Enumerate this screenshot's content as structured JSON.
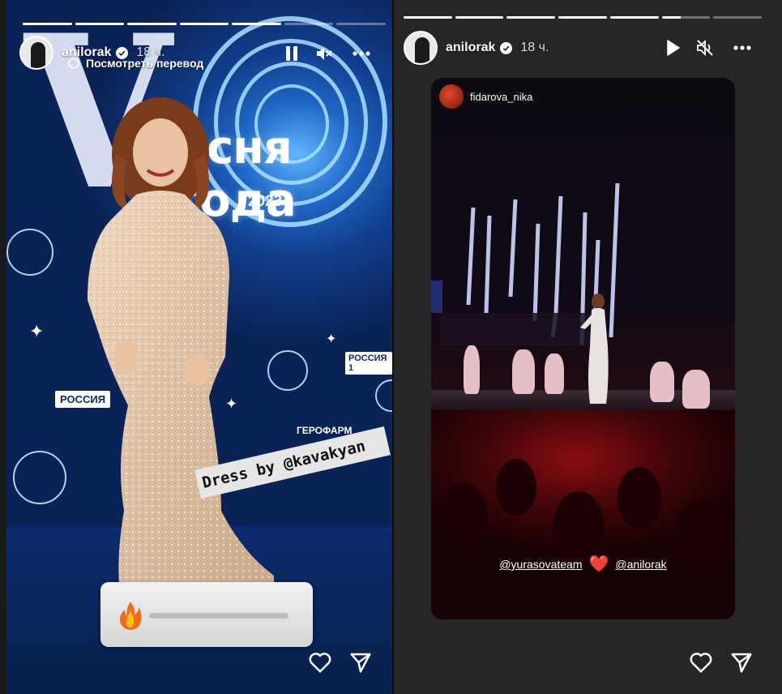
{
  "left_story": {
    "username": "anilorak",
    "time": "18 ч.",
    "translate_label": "Посмотреть перевод",
    "progress": [
      1,
      1,
      1,
      1,
      1,
      0,
      0
    ],
    "backdrop": {
      "logo_word": "есня года",
      "logo_year": "2023",
      "sponsor_rossiya": "РОССИЯ",
      "sponsor_rossiya1": "РОССИЯ 1",
      "sponsor_gerofarm": "ГЕРОФАРМ"
    },
    "sticker_text": "Dress by @kavakyan",
    "slider_emoji": "🔥",
    "icons": [
      "pause-icon",
      "mute-icon",
      "more-icon",
      "heart-icon",
      "share-icon"
    ]
  },
  "right_story": {
    "username": "anilorak",
    "time": "18 ч.",
    "progress": [
      1,
      1,
      1,
      1,
      1,
      0.4,
      0
    ],
    "repost": {
      "username": "fidarova_nika",
      "mention_1": "@yurasovateam",
      "mention_heart": "❤️",
      "mention_2": "@anilorak"
    },
    "icons": [
      "play-icon",
      "muted-icon",
      "more-icon",
      "heart-icon",
      "share-icon"
    ]
  },
  "colors": {
    "background": "#1a1a1a",
    "backdrop_blue": "#1f66c4",
    "heart_red": "#e0202a"
  }
}
